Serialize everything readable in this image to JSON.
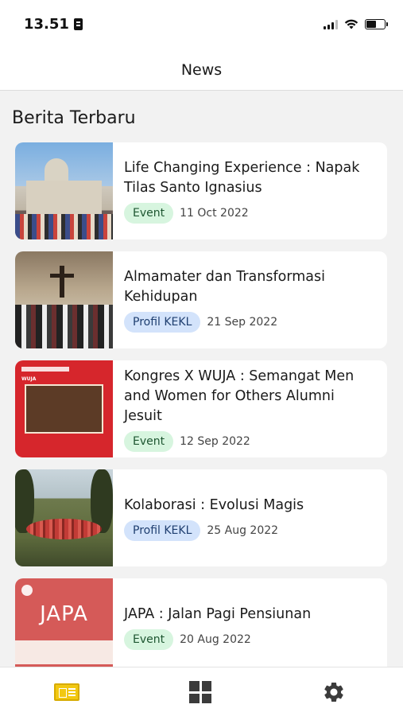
{
  "status_bar": {
    "time": "13.51"
  },
  "header": {
    "title": "News"
  },
  "section": {
    "title": "Berita Terbaru"
  },
  "articles": [
    {
      "title": "Life Changing Experience : Napak Tilas Santo Ignasius",
      "tag": "Event",
      "date": "11 Oct 2022"
    },
    {
      "title": "Almamater dan Transformasi Kehidupan",
      "tag": "Profil KEKL",
      "date": "21 Sep 2022"
    },
    {
      "title": "Kongres X WUJA : Semangat Men and Women for Others Alumni Jesuit",
      "tag": "Event",
      "date": "12 Sep 2022"
    },
    {
      "title": "Kolaborasi : Evolusi Magis",
      "tag": "Profil KEKL",
      "date": "25 Aug 2022"
    },
    {
      "title": "JAPA : Jalan Pagi Pensiunan",
      "tag": "Event",
      "date": "20 Aug 2022"
    }
  ],
  "thumb_text": {
    "japa": "JAPA",
    "wuja": "WUJA"
  },
  "tabs": [
    {
      "icon": "newspaper-icon",
      "active": true
    },
    {
      "icon": "grid-icon",
      "active": false
    },
    {
      "icon": "gear-icon",
      "active": false
    }
  ],
  "colors": {
    "event_tag_bg": "#d7f5df",
    "profil_tag_bg": "#d3e3fb",
    "active_tab": "#f2c811",
    "background": "#f2f2f2"
  }
}
